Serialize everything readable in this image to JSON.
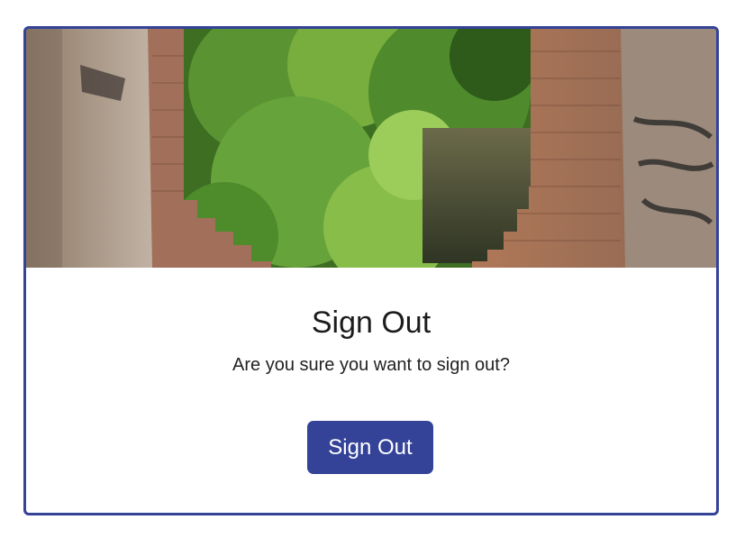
{
  "dialog": {
    "title": "Sign Out",
    "message": "Are you sure you want to sign out?",
    "button_label": "Sign Out"
  },
  "colors": {
    "accent": "#344397",
    "foliage": "#3f7a2a",
    "brick": "#a86a4e"
  }
}
